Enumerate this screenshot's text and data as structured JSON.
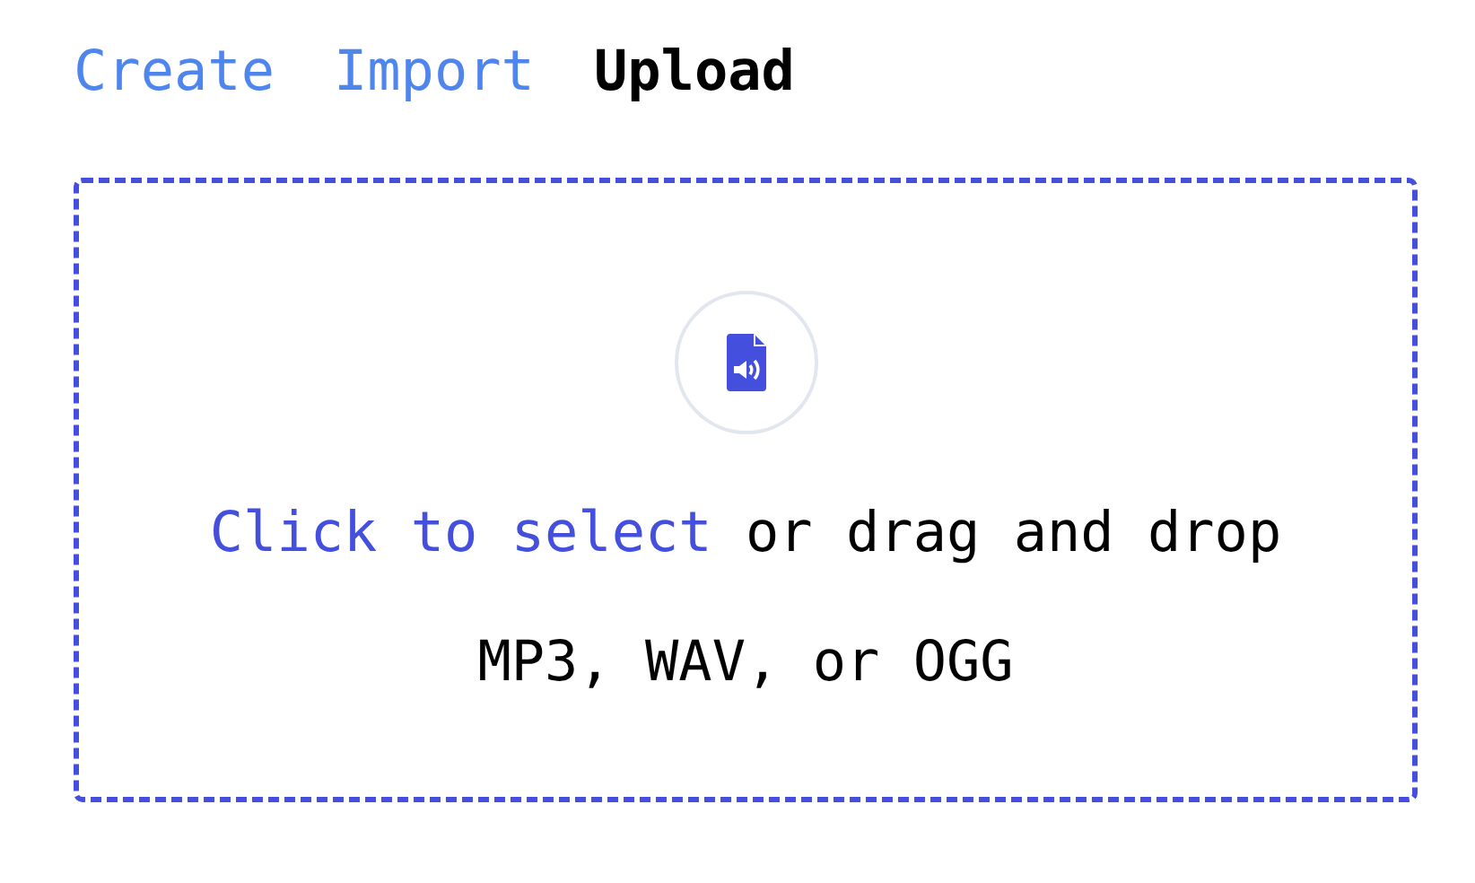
{
  "tabs": [
    {
      "label": "Create",
      "selected": false
    },
    {
      "label": "Import",
      "selected": false
    },
    {
      "label": "Upload",
      "selected": true
    }
  ],
  "dropzone": {
    "link": "Click to select",
    "text": "or drag and drop",
    "formats": "MP3, WAV, or OGG"
  }
}
